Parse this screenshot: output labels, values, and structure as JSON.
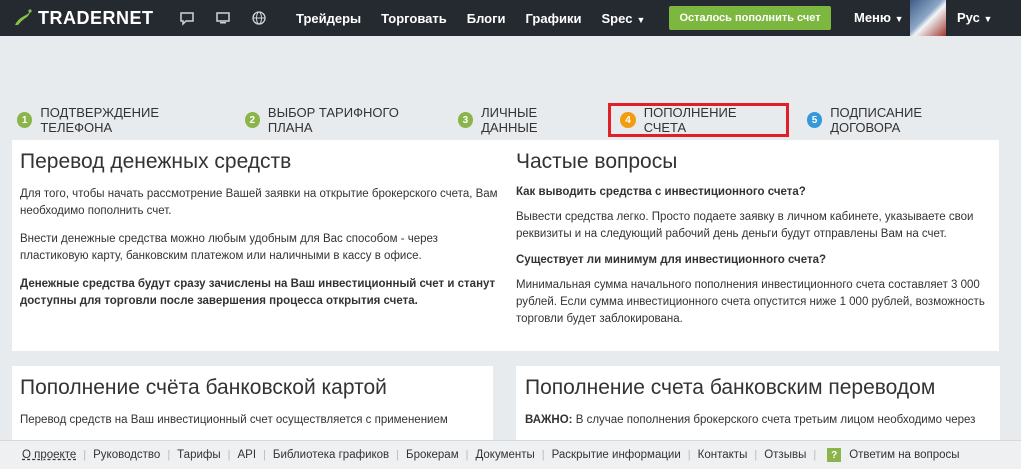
{
  "header": {
    "logo_text": "TRADERNET",
    "icons": [
      "chat-icon",
      "monitor-icon",
      "globe-icon"
    ],
    "nav": [
      {
        "label": "Трейдеры"
      },
      {
        "label": "Торговать"
      },
      {
        "label": "Блоги"
      },
      {
        "label": "Графики"
      },
      {
        "label": "Spec",
        "caret": "▼"
      }
    ],
    "cta_label": "Осталось пополнить счет",
    "menu_label": "Меню",
    "lang_label": "Рус",
    "caret": "▼"
  },
  "steps": [
    {
      "num": "1",
      "label": "ПОДТВЕРЖДЕНИЕ ТЕЛЕФОНА"
    },
    {
      "num": "2",
      "label": "ВЫБОР ТАРИФНОГО ПЛАНА"
    },
    {
      "num": "3",
      "label": "ЛИЧНЫЕ ДАННЫЕ"
    },
    {
      "num": "4",
      "label": "ПОПОЛНЕНИЕ СЧЕТА"
    },
    {
      "num": "5",
      "label": "ПОДПИСАНИЕ ДОГОВОРА"
    }
  ],
  "transfer": {
    "title": "Перевод денежных средств",
    "p1": "Для того, чтобы начать рассмотрение Вашей заявки на открытие брокерского счета, Вам необходимо пополнить счет.",
    "p2": "Внести денежные средства можно любым удобным для Вас способом - через пластиковую карту, банковским платежом или наличными в кассу в офисе.",
    "p3": "Денежные средства будут сразу зачислены на Ваш инвестиционный счет и станут доступны для торговли после завершения процесса открытия счета."
  },
  "faq": {
    "title": "Частые вопросы",
    "q1": "Как выводить средства с инвестиционного счета?",
    "a1": "Вывести средства легко. Просто подаете заявку в личном кабинете, указываете свои реквизиты и на следующий рабочий день деньги будут отправлены Вам на счет.",
    "q2": "Существует ли минимум для инвестиционного счета?",
    "a2": "Минимальная сумма начального пополнения инвестиционного счета составляет 3 000 рублей. Если сумма инвестиционного счета опустится ниже 1 000 рублей, возможность торговли будет заблокирована."
  },
  "card_topup": {
    "title": "Пополнение счёта банковской картой",
    "text": "Перевод средств на Ваш инвестиционный счет осуществляется с применением"
  },
  "bank_topup": {
    "title": "Пополнение счета банковским переводом",
    "important": "ВАЖНО:",
    "text": " В случае пополнения брокерского счета третьим лицом необходимо через"
  },
  "footer": {
    "links": [
      "О проекте",
      "Руководство",
      "Тарифы",
      "API",
      "Библиотека графиков",
      "Брокерам",
      "Документы",
      "Раскрытие информации",
      "Контакты",
      "Отзывы"
    ],
    "help_badge": "?",
    "help_label": "Ответим на вопросы"
  }
}
